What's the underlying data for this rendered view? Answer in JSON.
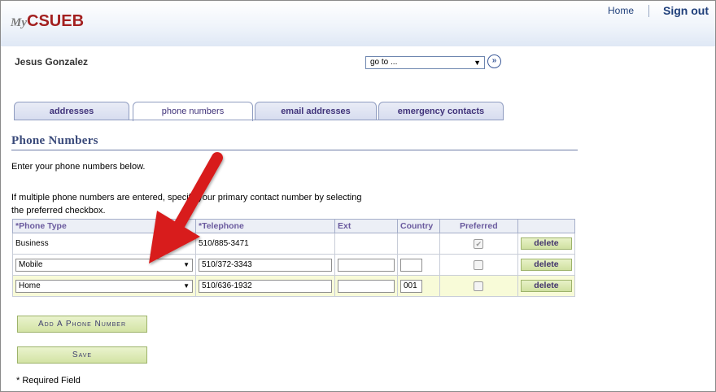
{
  "header": {
    "logo_my": "My",
    "logo_brand": "CSUEB",
    "home_label": "Home",
    "signout_label": "Sign out"
  },
  "user": {
    "name": "Jesus Gonzalez",
    "goto_value": "go to ...",
    "goto_button": "»"
  },
  "tabs": [
    {
      "label": "addresses",
      "active": false
    },
    {
      "label": "phone numbers",
      "active": true
    },
    {
      "label": "email addresses",
      "active": false
    },
    {
      "label": "emergency contacts",
      "active": false
    }
  ],
  "section": {
    "title": "Phone Numbers",
    "instruction": "Enter your phone numbers below.",
    "instruction2": "If multiple phone numbers are entered, specify your primary contact number by selecting the preferred checkbox."
  },
  "table": {
    "headers": [
      "*Phone Type",
      "*Telephone",
      "Ext",
      "Country",
      "Preferred",
      ""
    ],
    "rows": [
      {
        "type": "Business",
        "telephone": "510/885-3471",
        "ext": "",
        "country": "",
        "preferred": true,
        "delete_label": "delete"
      },
      {
        "type": "Mobile",
        "telephone": "510/372-3343",
        "ext": "",
        "country": "",
        "preferred": false,
        "delete_label": "delete"
      },
      {
        "type": "Home",
        "telephone": "510/636-1932",
        "ext": "",
        "country": "001",
        "preferred": false,
        "delete_label": "delete"
      }
    ]
  },
  "buttons": {
    "add_label": "Add A Phone Number",
    "save_label": "Save"
  },
  "footer": {
    "required_note": "* Required Field"
  },
  "colors": {
    "arrow": "#d81f1f",
    "logo": "#a32020",
    "tab_text": "#40337a"
  }
}
